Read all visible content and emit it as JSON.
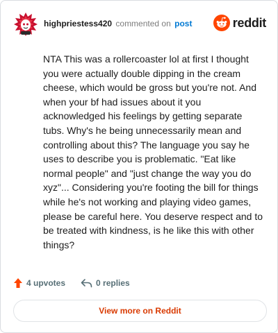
{
  "comment": {
    "username": "highpriestess420",
    "action_text": "commented on",
    "post_link": "post",
    "body": "NTA This was a rollercoaster lol at first I thought you were actually double dipping in the cream cheese, which would be gross but you're not. And when your bf had issues about it you acknowledged his feelings by getting separate tubs. Why's he being unnecessarily mean and controlling about this? The language you say he uses to describe you is problematic. \"Eat like normal people\" and \"just change the way you do xyz\"... Considering you're footing the bill for things while he's not working and playing video games, please be careful here. You deserve respect and to be treated with kindness, is he like this with other things?",
    "avatar_icon": "snoo-avatar-icon"
  },
  "brand": {
    "wordmark": "reddit",
    "logo_icon": "reddit-logo-icon",
    "accent_color": "#ff4500"
  },
  "footer": {
    "upvotes_label": "4 upvotes",
    "upvote_icon": "upvote-arrow-icon",
    "upvote_color": "#ff4500",
    "replies_label": "0 replies",
    "reply_icon": "reply-arrow-icon"
  },
  "cta": {
    "view_more_label": "View more on Reddit",
    "color": "#d93a00"
  }
}
